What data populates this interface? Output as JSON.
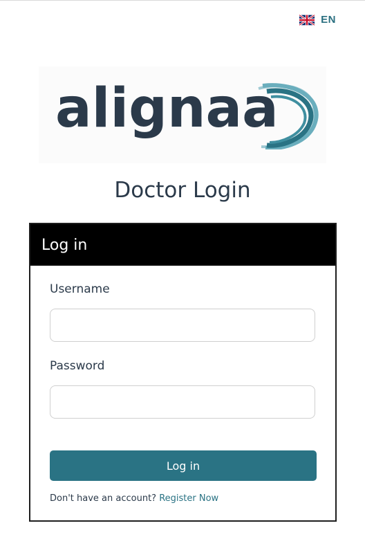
{
  "language": {
    "code": "EN",
    "flag_icon": "uk-flag-icon"
  },
  "logo": {
    "text": "alignaa",
    "icon": "swoosh-icon",
    "text_color": "#2b3a4a",
    "accent_color": "#2a7384"
  },
  "page": {
    "title": "Doctor Login"
  },
  "login_card": {
    "header": "Log in",
    "username_label": "Username",
    "username_value": "",
    "password_label": "Password",
    "password_value": "",
    "submit_label": "Log in",
    "register_prompt": "Don't have an account?",
    "register_link": "Register Now"
  },
  "colors": {
    "accent": "#2a7384",
    "header_bg": "#000000"
  }
}
